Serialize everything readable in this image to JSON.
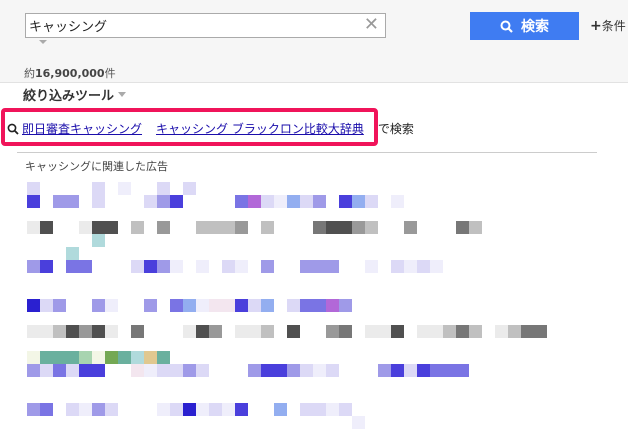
{
  "search": {
    "query": "キャッシング",
    "button_label": "検索",
    "conditions_label": "条件"
  },
  "results": {
    "count_prefix": "約",
    "count": "16,900,000",
    "count_suffix": "件"
  },
  "filter_tools_label": "絞り込みツール",
  "assist": {
    "links": [
      "即日審査キャッシング",
      "キャッシング ブラックロン比較大辞典"
    ],
    "suffix": "で検索",
    "highlight_color": "#f0145a"
  },
  "ads": {
    "label": "キャッシングに関連した広告"
  },
  "colors": {
    "search_button": "#3f7cf2",
    "link": "#1a0dab"
  }
}
